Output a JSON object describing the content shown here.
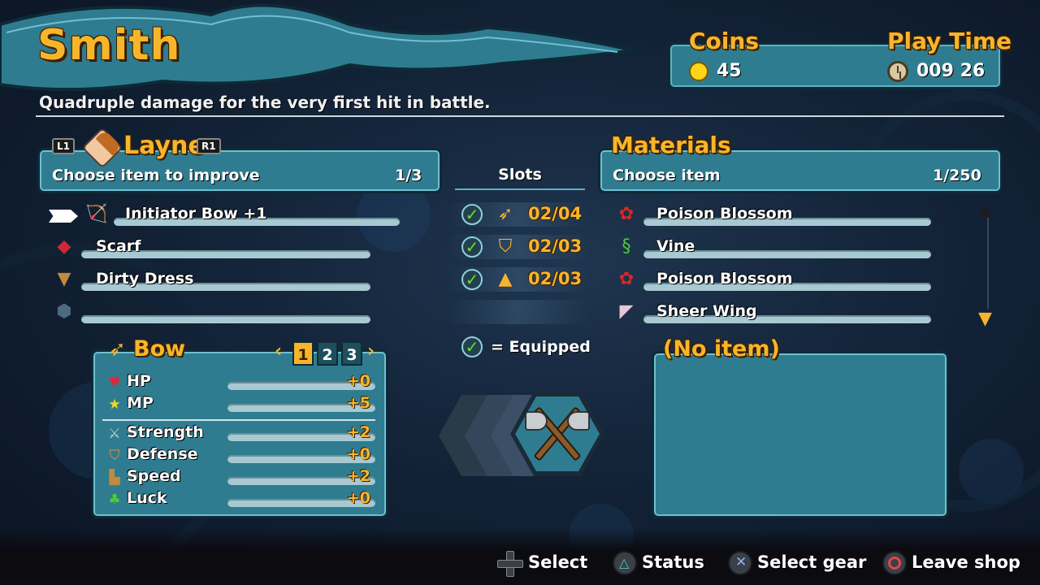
{
  "shop": {
    "title": "Smith",
    "description": "Quadruple damage for the very first hit in battle."
  },
  "status": {
    "coins_label": "Coins",
    "coins_value": "45",
    "playtime_label": "Play Time",
    "playtime_value": "009 26"
  },
  "left_panel": {
    "prev_button": "L1",
    "next_button": "R1",
    "character": "Layne",
    "prompt": "Choose item to improve",
    "count": "1/3",
    "items": [
      {
        "label": "Initiator Bow +1",
        "icon": "bow-icon"
      },
      {
        "label": "Scarf",
        "icon": "scarf-icon"
      },
      {
        "label": "Dirty Dress",
        "icon": "dress-icon"
      },
      {
        "label": "",
        "icon": "empty-slot-icon"
      }
    ]
  },
  "slots": {
    "header": "Slots",
    "rows": [
      {
        "icon": "bow-icon",
        "value": "02/04"
      },
      {
        "icon": "shield-icon",
        "value": "02/03"
      },
      {
        "icon": "armor-icon",
        "value": "02/03"
      }
    ],
    "legend": "= Equipped"
  },
  "stats": {
    "category": "Bow",
    "pages": [
      "1",
      "2",
      "3"
    ],
    "active_page": "1",
    "rows": [
      {
        "label": "HP",
        "value": "+0",
        "icon": "heart-icon"
      },
      {
        "label": "MP",
        "value": "+5",
        "icon": "star-icon"
      },
      {
        "label": "Strength",
        "value": "+2",
        "icon": "sword-icon"
      },
      {
        "label": "Defense",
        "value": "+0",
        "icon": "shield-icon"
      },
      {
        "label": "Speed",
        "value": "+2",
        "icon": "boot-icon"
      },
      {
        "label": "Luck",
        "value": "+0",
        "icon": "clover-icon"
      }
    ]
  },
  "materials": {
    "title": "Materials",
    "prompt": "Choose item",
    "count": "1/250",
    "items": [
      {
        "label": "Poison Blossom",
        "icon": "flower-icon"
      },
      {
        "label": "Vine",
        "icon": "vine-icon"
      },
      {
        "label": "Poison Blossom",
        "icon": "flower-icon"
      },
      {
        "label": "Sheer Wing",
        "icon": "wing-icon"
      }
    ],
    "detail_title": "(No item)"
  },
  "hints": {
    "select": "Select",
    "status": "Status",
    "select_gear": "Select gear",
    "leave": "Leave shop"
  },
  "colors": {
    "accent": "#f7b52c",
    "panel": "#2f7c90",
    "check": "#5fe03a"
  }
}
